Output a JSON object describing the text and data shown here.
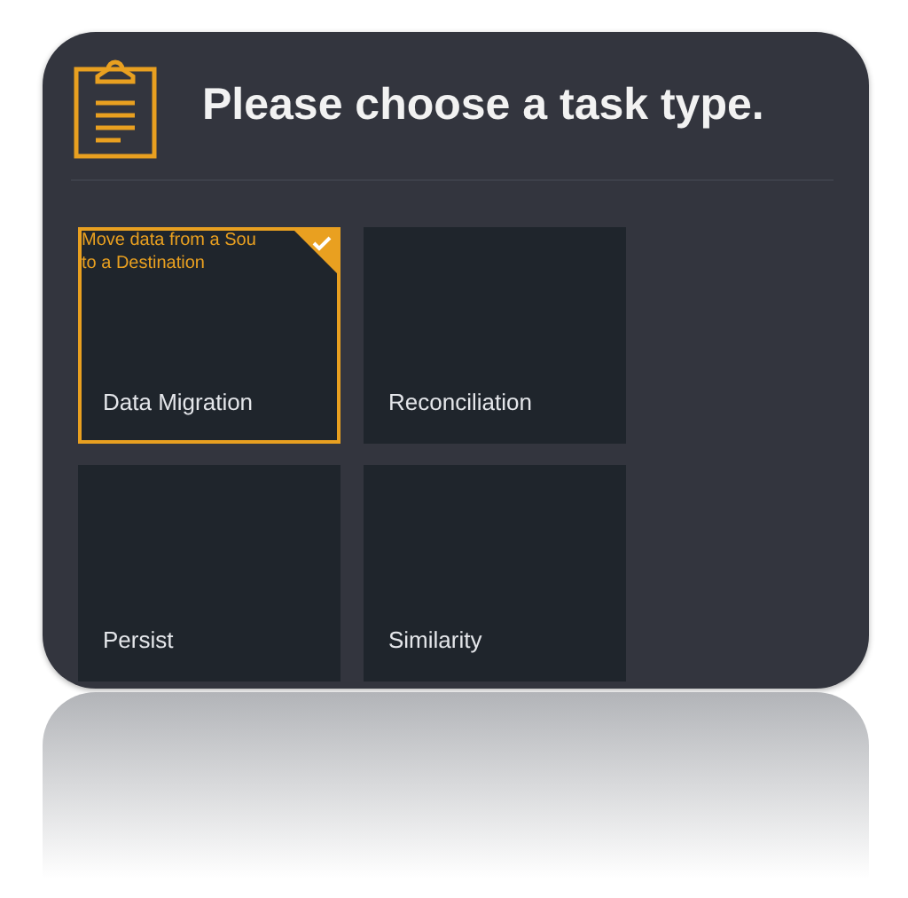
{
  "header": {
    "title": "Please choose a task type."
  },
  "tiles": [
    {
      "label": "Data Migration",
      "selected": true,
      "description_lines": [
        "Move data from a Sou",
        "to a Destination"
      ]
    },
    {
      "label": "Reconciliation",
      "selected": false
    },
    {
      "label": "Persist",
      "selected": false
    },
    {
      "label": "Similarity",
      "selected": false
    }
  ]
}
